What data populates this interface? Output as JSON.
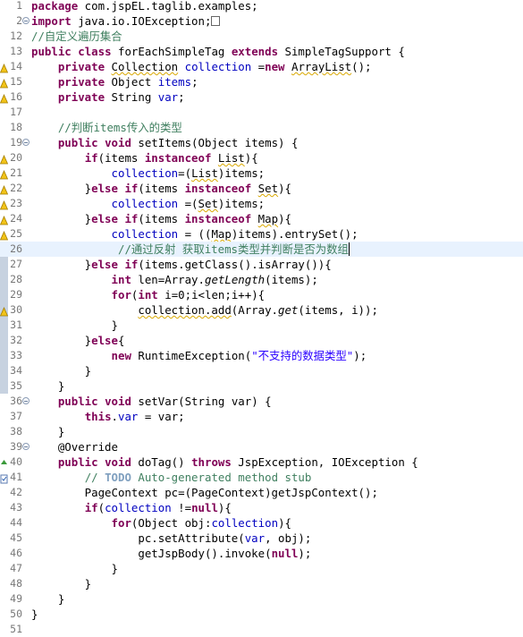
{
  "editor": {
    "language": "java",
    "current_line": 26,
    "colors": {
      "keyword": "#7f0055",
      "field": "#0000c0",
      "comment": "#3f7f5f",
      "todo": "#7f9fbf",
      "string": "#2a00ff",
      "current_line_bg": "#e8f2fe",
      "gutter_strip": "#c7d2e0"
    },
    "icons": [
      "warning-marker-icon",
      "override-marker-icon",
      "task-marker-icon",
      "fold-toggle-icon",
      "collapsed-import-icon"
    ],
    "lines": [
      {
        "n": "1",
        "segs": [
          {
            "t": "package",
            "c": "kw"
          },
          {
            "t": " com.jspEL.taglib.examples;"
          }
        ]
      },
      {
        "n": "2",
        "segs": [
          {
            "t": "import",
            "c": "kw"
          },
          {
            "t": " java.io.IOException;"
          }
        ]
      },
      {
        "n": "12",
        "segs": [
          {
            "t": "//自定义遍历集合",
            "c": "cm"
          }
        ]
      },
      {
        "n": "13",
        "segs": [
          {
            "t": "public",
            "c": "kw"
          },
          {
            "t": " "
          },
          {
            "t": "class",
            "c": "kw"
          },
          {
            "t": " forEachSimpleTag "
          },
          {
            "t": "extends",
            "c": "kw"
          },
          {
            "t": " SimpleTagSupport {"
          }
        ]
      },
      {
        "n": "14",
        "segs": [
          {
            "t": "    "
          },
          {
            "t": "private",
            "c": "kw"
          },
          {
            "t": " "
          },
          {
            "t": "Collection",
            "c": "sq"
          },
          {
            "t": " "
          },
          {
            "t": "collection",
            "c": "fld"
          },
          {
            "t": " ="
          },
          {
            "t": "new",
            "c": "kw"
          },
          {
            "t": " "
          },
          {
            "t": "ArrayList",
            "c": "sq"
          },
          {
            "t": "();"
          }
        ]
      },
      {
        "n": "15",
        "segs": [
          {
            "t": "    "
          },
          {
            "t": "private",
            "c": "kw"
          },
          {
            "t": " Object "
          },
          {
            "t": "items",
            "c": "fld"
          },
          {
            "t": ";"
          }
        ]
      },
      {
        "n": "16",
        "segs": [
          {
            "t": "    "
          },
          {
            "t": "private",
            "c": "kw"
          },
          {
            "t": " String "
          },
          {
            "t": "var",
            "c": "fld"
          },
          {
            "t": ";"
          }
        ]
      },
      {
        "n": "17",
        "segs": []
      },
      {
        "n": "18",
        "segs": [
          {
            "t": "    "
          },
          {
            "t": "//判断items传入的类型",
            "c": "cm"
          }
        ]
      },
      {
        "n": "19",
        "segs": [
          {
            "t": "    "
          },
          {
            "t": "public",
            "c": "kw"
          },
          {
            "t": " "
          },
          {
            "t": "void",
            "c": "kw"
          },
          {
            "t": " setItems(Object items) {"
          }
        ]
      },
      {
        "n": "20",
        "segs": [
          {
            "t": "        "
          },
          {
            "t": "if",
            "c": "kw"
          },
          {
            "t": "(items "
          },
          {
            "t": "instanceof",
            "c": "kw"
          },
          {
            "t": " "
          },
          {
            "t": "List",
            "c": "sq"
          },
          {
            "t": "){"
          }
        ]
      },
      {
        "n": "21",
        "segs": [
          {
            "t": "            "
          },
          {
            "t": "collection",
            "c": "fld"
          },
          {
            "t": "=("
          },
          {
            "t": "List",
            "c": "sq"
          },
          {
            "t": ")items;"
          }
        ]
      },
      {
        "n": "22",
        "segs": [
          {
            "t": "        }"
          },
          {
            "t": "else",
            "c": "kw"
          },
          {
            "t": " "
          },
          {
            "t": "if",
            "c": "kw"
          },
          {
            "t": "(items "
          },
          {
            "t": "instanceof",
            "c": "kw"
          },
          {
            "t": " "
          },
          {
            "t": "Set",
            "c": "sq"
          },
          {
            "t": "){"
          }
        ]
      },
      {
        "n": "23",
        "segs": [
          {
            "t": "            "
          },
          {
            "t": "collection",
            "c": "fld"
          },
          {
            "t": " =("
          },
          {
            "t": "Set",
            "c": "sq"
          },
          {
            "t": ")items;"
          }
        ]
      },
      {
        "n": "24",
        "segs": [
          {
            "t": "        }"
          },
          {
            "t": "else",
            "c": "kw"
          },
          {
            "t": " "
          },
          {
            "t": "if",
            "c": "kw"
          },
          {
            "t": "(items "
          },
          {
            "t": "instanceof",
            "c": "kw"
          },
          {
            "t": " "
          },
          {
            "t": "Map",
            "c": "sq"
          },
          {
            "t": "){"
          }
        ]
      },
      {
        "n": "25",
        "segs": [
          {
            "t": "            "
          },
          {
            "t": "collection",
            "c": "fld"
          },
          {
            "t": " = (("
          },
          {
            "t": "Map",
            "c": "sq"
          },
          {
            "t": ")items).entrySet();"
          }
        ]
      },
      {
        "n": "26",
        "segs": [
          {
            "t": "             "
          },
          {
            "t": "//通过反射 获取items类型并判断是否为数组",
            "c": "cm"
          }
        ]
      },
      {
        "n": "27",
        "segs": [
          {
            "t": "        }"
          },
          {
            "t": "else",
            "c": "kw"
          },
          {
            "t": " "
          },
          {
            "t": "if",
            "c": "kw"
          },
          {
            "t": "(items.getClass().isArray()){"
          }
        ]
      },
      {
        "n": "28",
        "segs": [
          {
            "t": "            "
          },
          {
            "t": "int",
            "c": "kw"
          },
          {
            "t": " len=Array."
          },
          {
            "t": "getLength",
            "c": "ital"
          },
          {
            "t": "(items);"
          }
        ]
      },
      {
        "n": "29",
        "segs": [
          {
            "t": "            "
          },
          {
            "t": "for",
            "c": "kw"
          },
          {
            "t": "("
          },
          {
            "t": "int",
            "c": "kw"
          },
          {
            "t": " i=0;i<len;i++){"
          }
        ]
      },
      {
        "n": "30",
        "segs": [
          {
            "t": "                "
          },
          {
            "t": "collection.add",
            "c": "sq"
          },
          {
            "t": "(Array."
          },
          {
            "t": "get",
            "c": "ital"
          },
          {
            "t": "(items, i));"
          }
        ]
      },
      {
        "n": "31",
        "segs": [
          {
            "t": "            }"
          }
        ]
      },
      {
        "n": "32",
        "segs": [
          {
            "t": "        }"
          },
          {
            "t": "else",
            "c": "kw"
          },
          {
            "t": "{"
          }
        ]
      },
      {
        "n": "33",
        "segs": [
          {
            "t": "            "
          },
          {
            "t": "new",
            "c": "kw"
          },
          {
            "t": " RuntimeException("
          },
          {
            "t": "\"不支持的数据类型\"",
            "c": "str"
          },
          {
            "t": ");"
          }
        ]
      },
      {
        "n": "34",
        "segs": [
          {
            "t": "        }"
          }
        ]
      },
      {
        "n": "35",
        "segs": [
          {
            "t": "    }"
          }
        ]
      },
      {
        "n": "36",
        "segs": [
          {
            "t": "    "
          },
          {
            "t": "public",
            "c": "kw"
          },
          {
            "t": " "
          },
          {
            "t": "void",
            "c": "kw"
          },
          {
            "t": " setVar(String var) {"
          }
        ]
      },
      {
        "n": "37",
        "segs": [
          {
            "t": "        "
          },
          {
            "t": "this",
            "c": "kw"
          },
          {
            "t": "."
          },
          {
            "t": "var",
            "c": "fld"
          },
          {
            "t": " = var;"
          }
        ]
      },
      {
        "n": "38",
        "segs": [
          {
            "t": "    }"
          }
        ]
      },
      {
        "n": "39",
        "segs": [
          {
            "t": "    @Override"
          }
        ]
      },
      {
        "n": "40",
        "segs": [
          {
            "t": "    "
          },
          {
            "t": "public",
            "c": "kw"
          },
          {
            "t": " "
          },
          {
            "t": "void",
            "c": "kw"
          },
          {
            "t": " doTag() "
          },
          {
            "t": "throws",
            "c": "kw"
          },
          {
            "t": " JspException, IOException {"
          }
        ]
      },
      {
        "n": "41",
        "segs": [
          {
            "t": "        "
          },
          {
            "t": "// ",
            "c": "cm"
          },
          {
            "t": "TODO",
            "c": "todo"
          },
          {
            "t": " Auto-generated method stub",
            "c": "cm"
          }
        ]
      },
      {
        "n": "42",
        "segs": [
          {
            "t": "        PageContext pc=(PageContext)getJspContext();"
          }
        ]
      },
      {
        "n": "43",
        "segs": [
          {
            "t": "        "
          },
          {
            "t": "if",
            "c": "kw"
          },
          {
            "t": "("
          },
          {
            "t": "collection",
            "c": "fld"
          },
          {
            "t": " !="
          },
          {
            "t": "null",
            "c": "kw"
          },
          {
            "t": "){"
          }
        ]
      },
      {
        "n": "44",
        "segs": [
          {
            "t": "            "
          },
          {
            "t": "for",
            "c": "kw"
          },
          {
            "t": "(Object obj:"
          },
          {
            "t": "collection",
            "c": "fld"
          },
          {
            "t": "){"
          }
        ]
      },
      {
        "n": "45",
        "segs": [
          {
            "t": "                pc.setAttribute("
          },
          {
            "t": "var",
            "c": "fld"
          },
          {
            "t": ", obj);"
          }
        ]
      },
      {
        "n": "46",
        "segs": [
          {
            "t": "                getJspBody().invoke("
          },
          {
            "t": "null",
            "c": "kw"
          },
          {
            "t": ");"
          }
        ]
      },
      {
        "n": "47",
        "segs": [
          {
            "t": "            }"
          }
        ]
      },
      {
        "n": "48",
        "segs": [
          {
            "t": "        }"
          }
        ]
      },
      {
        "n": "49",
        "segs": [
          {
            "t": "    }"
          }
        ]
      },
      {
        "n": "50",
        "segs": [
          {
            "t": "}"
          }
        ]
      },
      {
        "n": "51",
        "segs": []
      }
    ]
  }
}
